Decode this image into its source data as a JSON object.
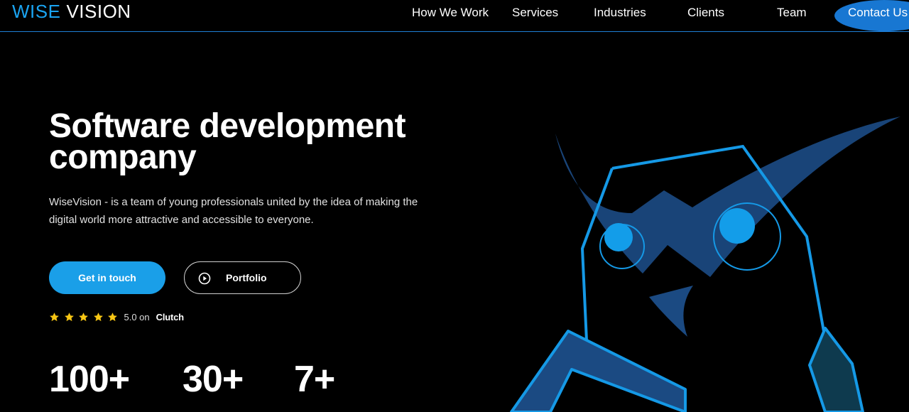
{
  "brand": {
    "logo_part1": "WISE",
    "logo_part2": "VISION"
  },
  "nav": {
    "items": [
      "How We Work",
      "Services",
      "Industries",
      "Clients",
      "Team"
    ],
    "contact_label": "Contact Us"
  },
  "hero": {
    "title_line1": "Software development",
    "title_line2": "company",
    "subtitle": "WiseVision - is a team of young professionals united by the idea of making the digital world more attractive and accessible to everyone.",
    "primary_button": "Get in touch",
    "secondary_button": "Portfolio",
    "rating_value": "5.0 on",
    "rating_source": "Clutch",
    "stars": 5
  },
  "stats": [
    "100+",
    "30+",
    "7+"
  ],
  "colors": {
    "accent": "#1a9fe8",
    "nav_button": "#1877d2",
    "star": "#f7c614",
    "owl_fill": "#1b4a82",
    "owl_line": "#1599e6"
  },
  "icons": {
    "portfolio": "play-circle-icon",
    "rating": "star-icon"
  }
}
